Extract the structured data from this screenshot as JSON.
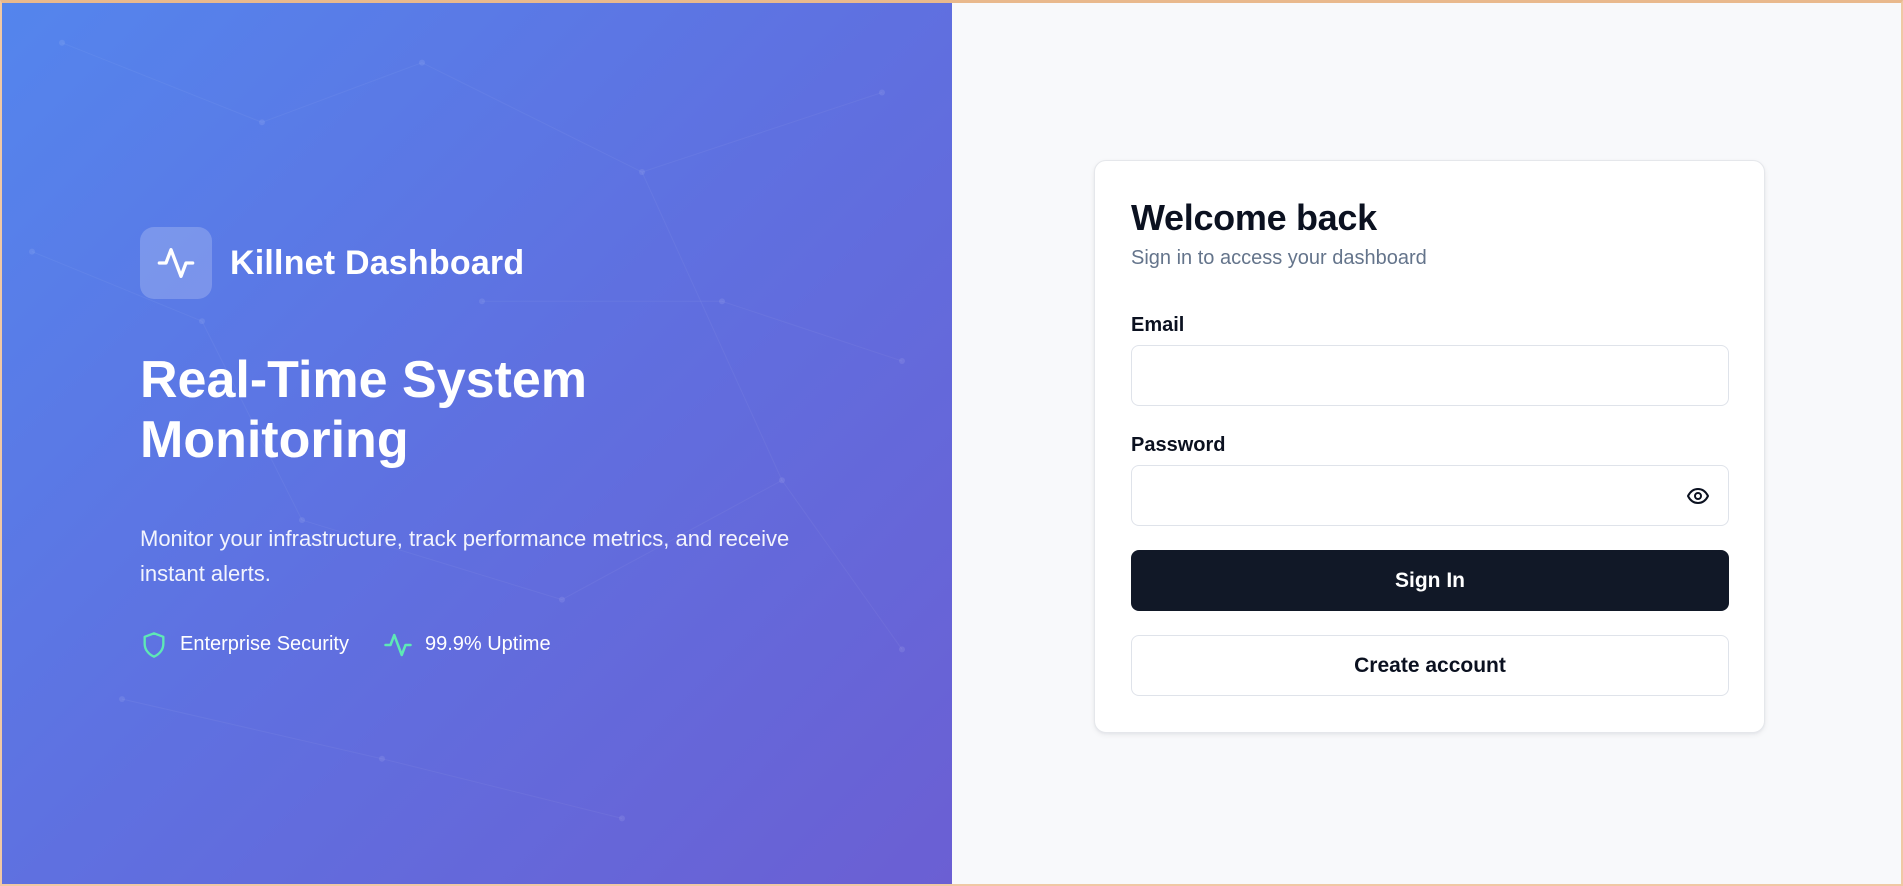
{
  "brand": {
    "name": "Killnet Dashboard",
    "logo_icon": "activity-pulse-icon"
  },
  "hero": {
    "headline": "Real-Time System Monitoring",
    "description": "Monitor your infrastructure, track performance metrics, and receive instant alerts.",
    "features": [
      {
        "icon": "shield-icon",
        "label": "Enterprise Security"
      },
      {
        "icon": "activity-pulse-icon",
        "label": "99.9% Uptime"
      }
    ]
  },
  "login": {
    "title": "Welcome back",
    "subtitle": "Sign in to access your dashboard",
    "email_label": "Email",
    "email_value": "",
    "email_placeholder": "",
    "password_label": "Password",
    "password_value": "",
    "password_placeholder": "",
    "show_password_icon": "eye-icon",
    "sign_in_label": "Sign In",
    "create_account_label": "Create account"
  },
  "colors": {
    "hero_gradient_start": "#5485ed",
    "hero_gradient_end": "#6b5fd3",
    "feature_icon": "#5ee9b5",
    "primary_button": "#111827",
    "page_background": "#f8f9fb"
  }
}
